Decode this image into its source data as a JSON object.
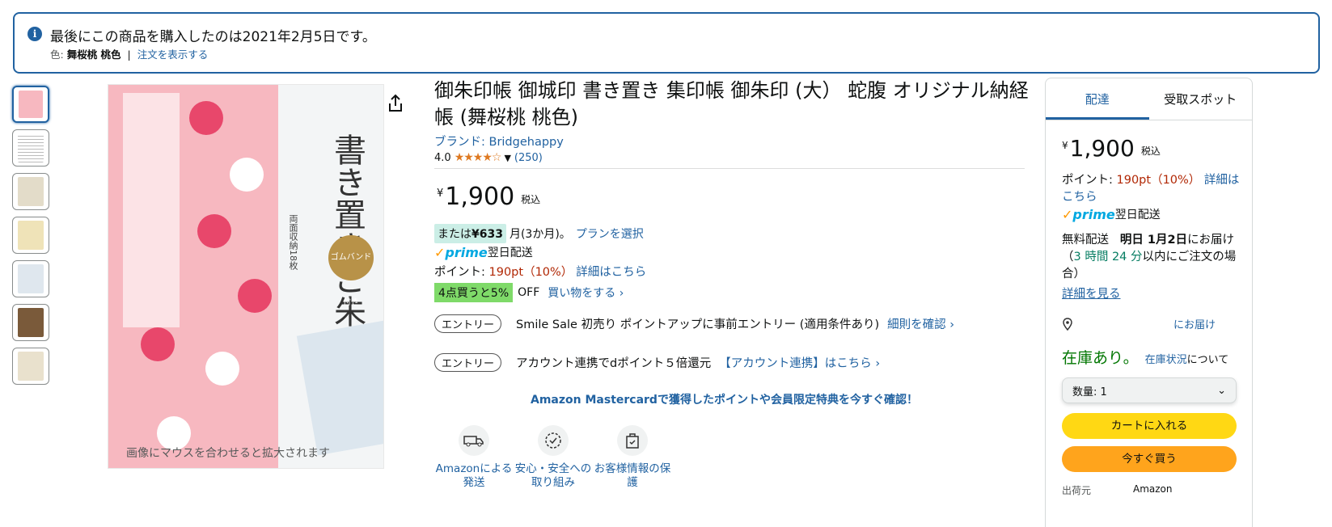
{
  "banner": {
    "message": "最後にこの商品を購入したのは2021年2月5日です。",
    "color_label": "色:",
    "color_value": "舞桜桃 桃色",
    "separator": "|",
    "view_order_link": "注文を表示する"
  },
  "gallery": {
    "thumbnail_count": 7,
    "zoom_hint": "画像にマウスを合わせると拡大されます",
    "image_text": {
      "title": "書き置きご朱印帳",
      "subtitle": "両面収納18枚",
      "badge": "ゴムバンド付き"
    }
  },
  "product": {
    "title": "御朱印帳 御城印 書き置き 集印帳 御朱印 (大） 蛇腹 オリジナル納経帳 (舞桜桃 桃色)",
    "brand": "ブランド: Bridgehappy",
    "rating_value": "4.0",
    "rating_count": "(250)",
    "price_symbol": "¥",
    "price": "1,900",
    "tax_label": "税込",
    "installment": {
      "prefix": "または",
      "amount": "¥633",
      "suffix": "月(3か月)。",
      "plan_link": "プランを選択"
    },
    "prime_label": "prime",
    "next_day": "翌日配送",
    "points": {
      "label": "ポイント: ",
      "value": "190pt（10%）",
      "details_link": "詳細はこちら"
    },
    "buy_more": {
      "badge": "4点買うと5%",
      "off": "OFF",
      "shop_link": "買い物をする ›"
    },
    "entries": [
      {
        "pill": "エントリー",
        "text": "Smile Sale 初売り ポイントアップに事前エントリー (適用条件あり)",
        "link": "細則を確認 ›"
      },
      {
        "pill": "エントリー",
        "text": "アカウント連携でdポイント５倍還元",
        "link": "【アカウント連携】はこちら ›"
      }
    ],
    "mastercard_promo": "Amazon Mastercardで獲得したポイントや会員限定特典を今すぐ確認！",
    "features": [
      {
        "label": "Amazonによる発送",
        "icon": "truck-icon"
      },
      {
        "label": "安心・安全への取り組み",
        "icon": "badge-icon"
      },
      {
        "label": "お客様情報の保護",
        "icon": "secure-bag-icon"
      }
    ]
  },
  "buybox": {
    "tabs": [
      "配達",
      "受取スポット"
    ],
    "price_symbol": "¥",
    "price": "1,900",
    "tax_label": "税込",
    "points_label": "ポイント: ",
    "points_value": "190pt（10%）",
    "points_details": "詳細はこちら",
    "prime_label": "prime",
    "next_day": "翌日配送",
    "free_shipping": "無料配送",
    "delivery_date": "明日 1月2日",
    "delivery_suffix": "にお届け",
    "order_within_prefix": "（",
    "order_within_time": "3 時間 24 分",
    "order_within_suffix": "以内にご注文の場合）",
    "details_link": "詳細を見る",
    "deliver_to": "にお届け",
    "in_stock": "在庫あり。",
    "stock_status_link": "在庫状況",
    "stock_status_suffix": "について",
    "quantity_label": "数量: 1",
    "add_to_cart": "カートに入れる",
    "buy_now": "今すぐ買う",
    "ships_from_label": "出荷元",
    "ships_from_value": "Amazon"
  },
  "colors": {
    "link": "#2162a1",
    "price_red": "#b12704",
    "in_stock_green": "#007600",
    "cart_yellow": "#ffd814",
    "buy_orange": "#ffa41c",
    "star_orange": "#de7921"
  }
}
